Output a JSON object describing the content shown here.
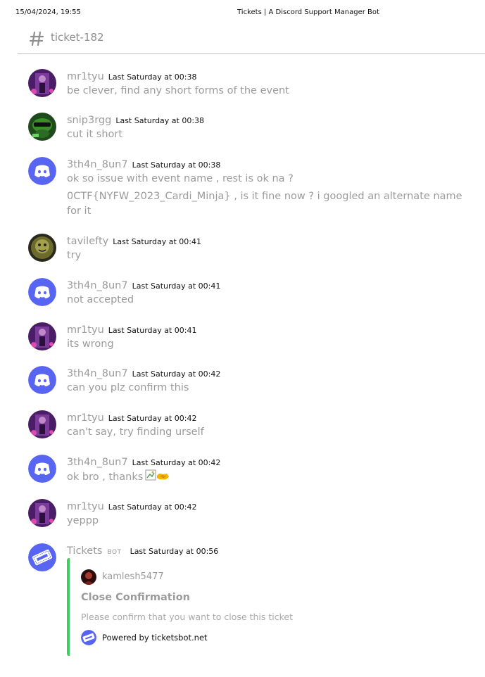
{
  "print": {
    "date": "15/04/2024, 19:55",
    "title": "Tickets | A Discord Support Manager Bot"
  },
  "channel": {
    "name": "ticket-182",
    "icon": "hash-icon"
  },
  "messages": [
    {
      "author": "mr1tyu",
      "timestamp": "Last Saturday at 00:38",
      "avatar": "purple-avatar",
      "lines": [
        "be clever, find any short forms of the event"
      ]
    },
    {
      "author": "snip3rgg",
      "timestamp": "Last Saturday at 00:38",
      "avatar": "green-avatar",
      "lines": [
        "cut it short"
      ]
    },
    {
      "author": "3th4n_8un7",
      "timestamp": "Last Saturday at 00:38",
      "avatar": "discord-avatar",
      "lines": [
        "ok so issue with event name , rest is ok na ?",
        "0CTF{NYFW_2023_Cardi_Minja} , is it fine now ? i googled an alternate name for it"
      ]
    },
    {
      "author": "tavilefty",
      "timestamp": "Last Saturday at 00:41",
      "avatar": "olive-avatar",
      "lines": [
        "try"
      ]
    },
    {
      "author": "3th4n_8un7",
      "timestamp": "Last Saturday at 00:41",
      "avatar": "discord-avatar",
      "lines": [
        "not accepted"
      ]
    },
    {
      "author": "mr1tyu",
      "timestamp": "Last Saturday at 00:41",
      "avatar": "purple-avatar",
      "lines": [
        "its wrong"
      ]
    },
    {
      "author": "3th4n_8un7",
      "timestamp": "Last Saturday at 00:42",
      "avatar": "discord-avatar",
      "lines": [
        "can you plz confirm this"
      ]
    },
    {
      "author": "mr1tyu",
      "timestamp": "Last Saturday at 00:42",
      "avatar": "purple-avatar",
      "lines": [
        "can't say, try finding urself"
      ]
    },
    {
      "author": "3th4n_8un7",
      "timestamp": "Last Saturday at 00:42",
      "avatar": "discord-avatar",
      "lines": [
        "ok bro , thanks"
      ],
      "emoji": "handshake-emoji"
    },
    {
      "author": "mr1tyu",
      "timestamp": "Last Saturday at 00:42",
      "avatar": "purple-avatar",
      "lines": [
        "yeppp"
      ]
    },
    {
      "author": "Tickets",
      "tag": "BOT",
      "timestamp": "Last Saturday at 00:56",
      "avatar": "tickets-bot-avatar",
      "lines": []
    }
  ],
  "embed": {
    "accent_color": "#3ecf60",
    "author": "kamlesh5477",
    "title": "Close Confirmation",
    "description": "Please confirm that you want to close this ticket",
    "footer": "Powered by ticketsbot.net"
  },
  "colors": {
    "discord_blurple": "#5865f2",
    "text": "#9b9b9b"
  }
}
